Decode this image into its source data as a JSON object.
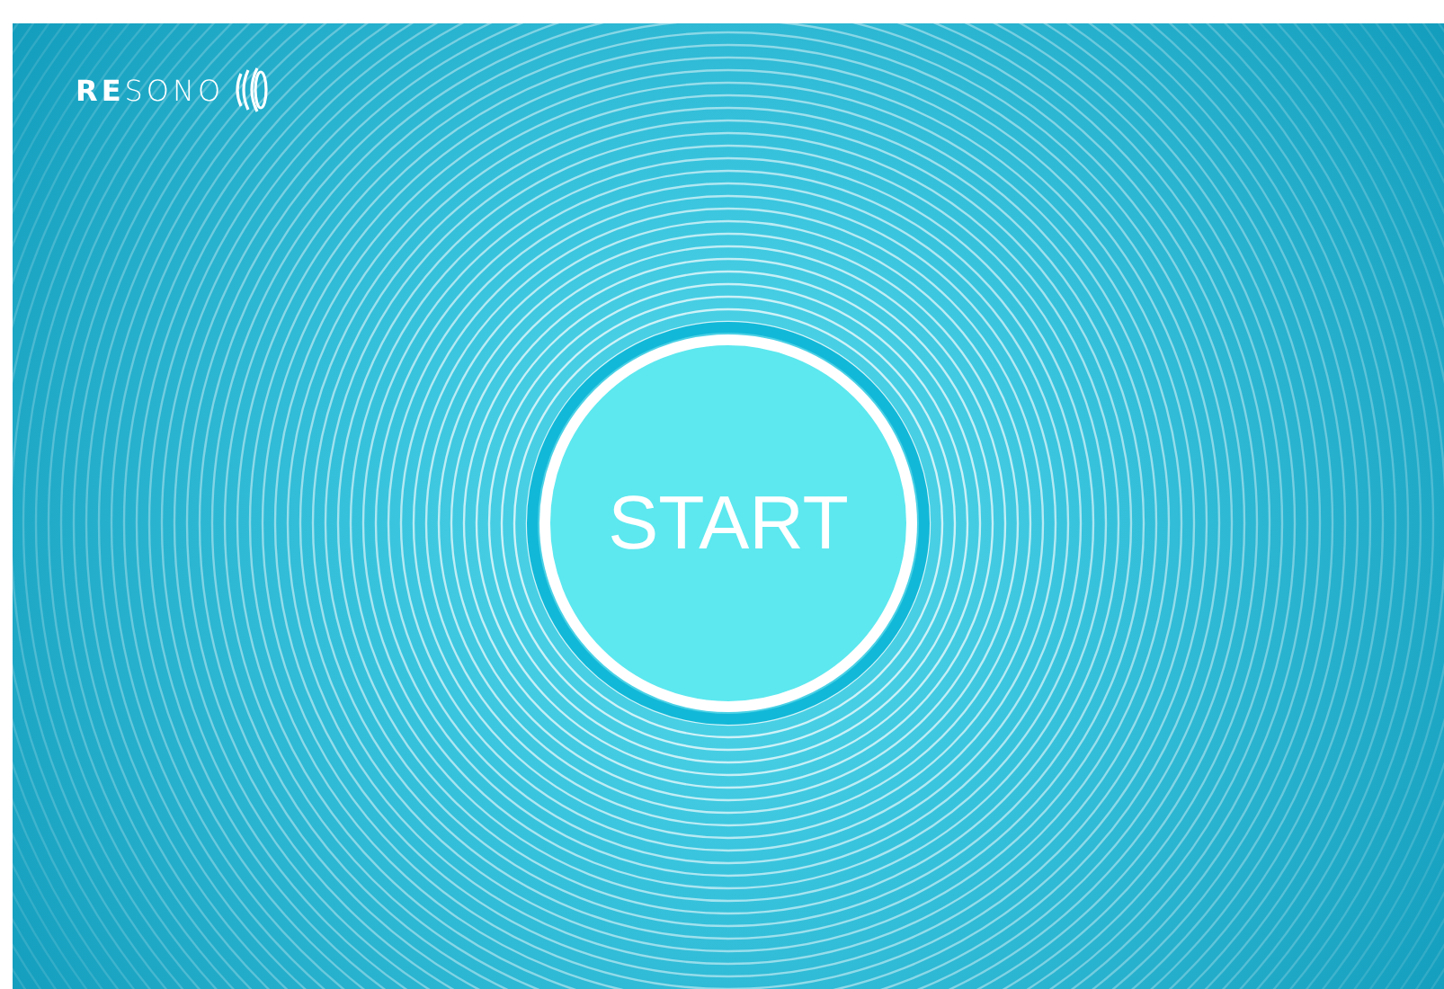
{
  "logo": {
    "text": "**RE**SONO"
  },
  "start_button": {
    "label": "START"
  }
}
